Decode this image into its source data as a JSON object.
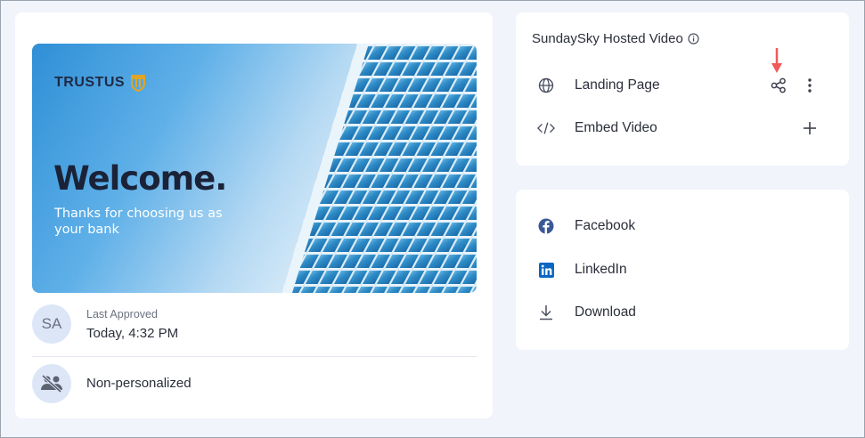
{
  "thumbnail": {
    "brand": "TRUSTUS",
    "headline": "Welcome.",
    "subtitle": "Thanks for choosing us as your bank"
  },
  "approval": {
    "avatar_initials": "SA",
    "label": "Last Approved",
    "value": "Today, 4:32 PM"
  },
  "personalization": {
    "label": "Non-personalized"
  },
  "hosted": {
    "title": "SundaySky Hosted Video",
    "landing_page": "Landing Page",
    "embed_video": "Embed Video"
  },
  "share": {
    "facebook": "Facebook",
    "linkedin": "LinkedIn",
    "download": "Download"
  },
  "colors": {
    "accent_arrow": "#f05a5a",
    "facebook": "#3b5998",
    "linkedin": "#0a66c2"
  }
}
